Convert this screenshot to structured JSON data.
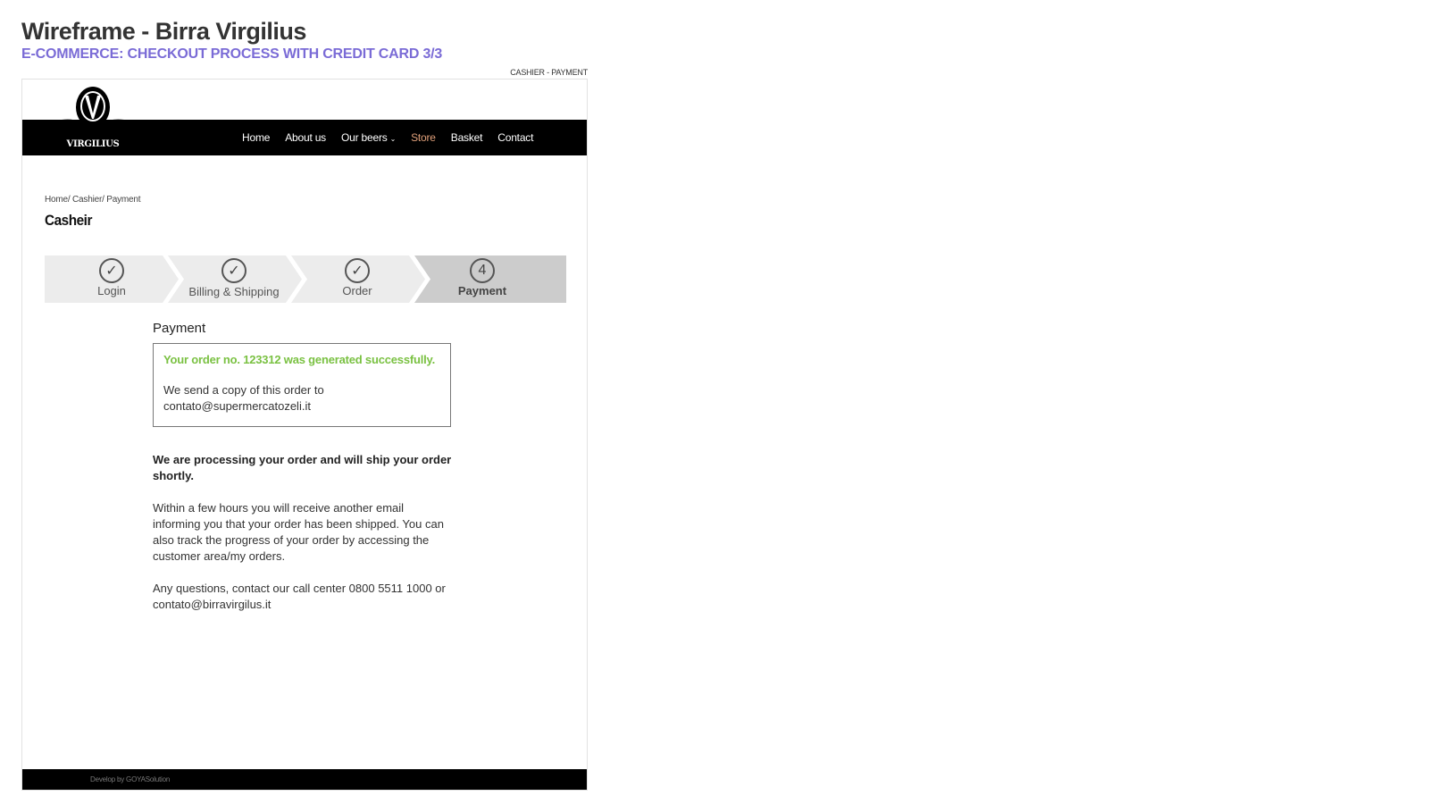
{
  "document": {
    "title": "Wireframe - Birra Virgilius",
    "subtitle": "E-COMMERCE:  CHECKOUT PROCESS WITH CREDIT CARD 3/3",
    "screen_tag": "CASHIER - PAYMENT"
  },
  "brand": {
    "logo_letter": "V",
    "logo_text": "VIRGILIUS"
  },
  "nav": {
    "items": [
      {
        "label": "Home"
      },
      {
        "label": "About us"
      },
      {
        "label": "Our beers",
        "has_dropdown": true
      },
      {
        "label": "Store",
        "active": true
      },
      {
        "label": "Basket"
      },
      {
        "label": "Contact"
      }
    ],
    "dropdown_glyph": "⌄",
    "active_color": "#e0a07a"
  },
  "breadcrumb": "Home/ Cashier/ Payment",
  "page_title": "Casheir",
  "stepper": {
    "steps": [
      {
        "label": "Login",
        "status": "done",
        "icon": "✓"
      },
      {
        "label": "Billing & Shipping",
        "status": "done",
        "icon": "✓"
      },
      {
        "label": "Order",
        "status": "done",
        "icon": "✓"
      },
      {
        "label": "Payment",
        "status": "current",
        "icon": "4"
      }
    ]
  },
  "payment": {
    "heading": "Payment",
    "success_message": "Your order no. 123312 was generated successfully.",
    "copy_message": "We send a copy of this order to contato@supermercatozeli.it",
    "processing_message": "We are processing your order and will ship your order shortly.",
    "shipping_info": "Within a few hours you will receive another email informing you that your order has been shipped. You can also track the progress of your order by accessing the customer area/my orders.",
    "contact_info": "Any questions, contact our call center 0800 5511 1000 or contato@birravirgilus.it"
  },
  "footer": {
    "credit": "Develop by GOYASolution"
  },
  "colors": {
    "success": "#7ac142",
    "subtitle": "#7a6bd6",
    "step_done_bg": "#ececec",
    "step_current_bg": "#cccccc"
  }
}
